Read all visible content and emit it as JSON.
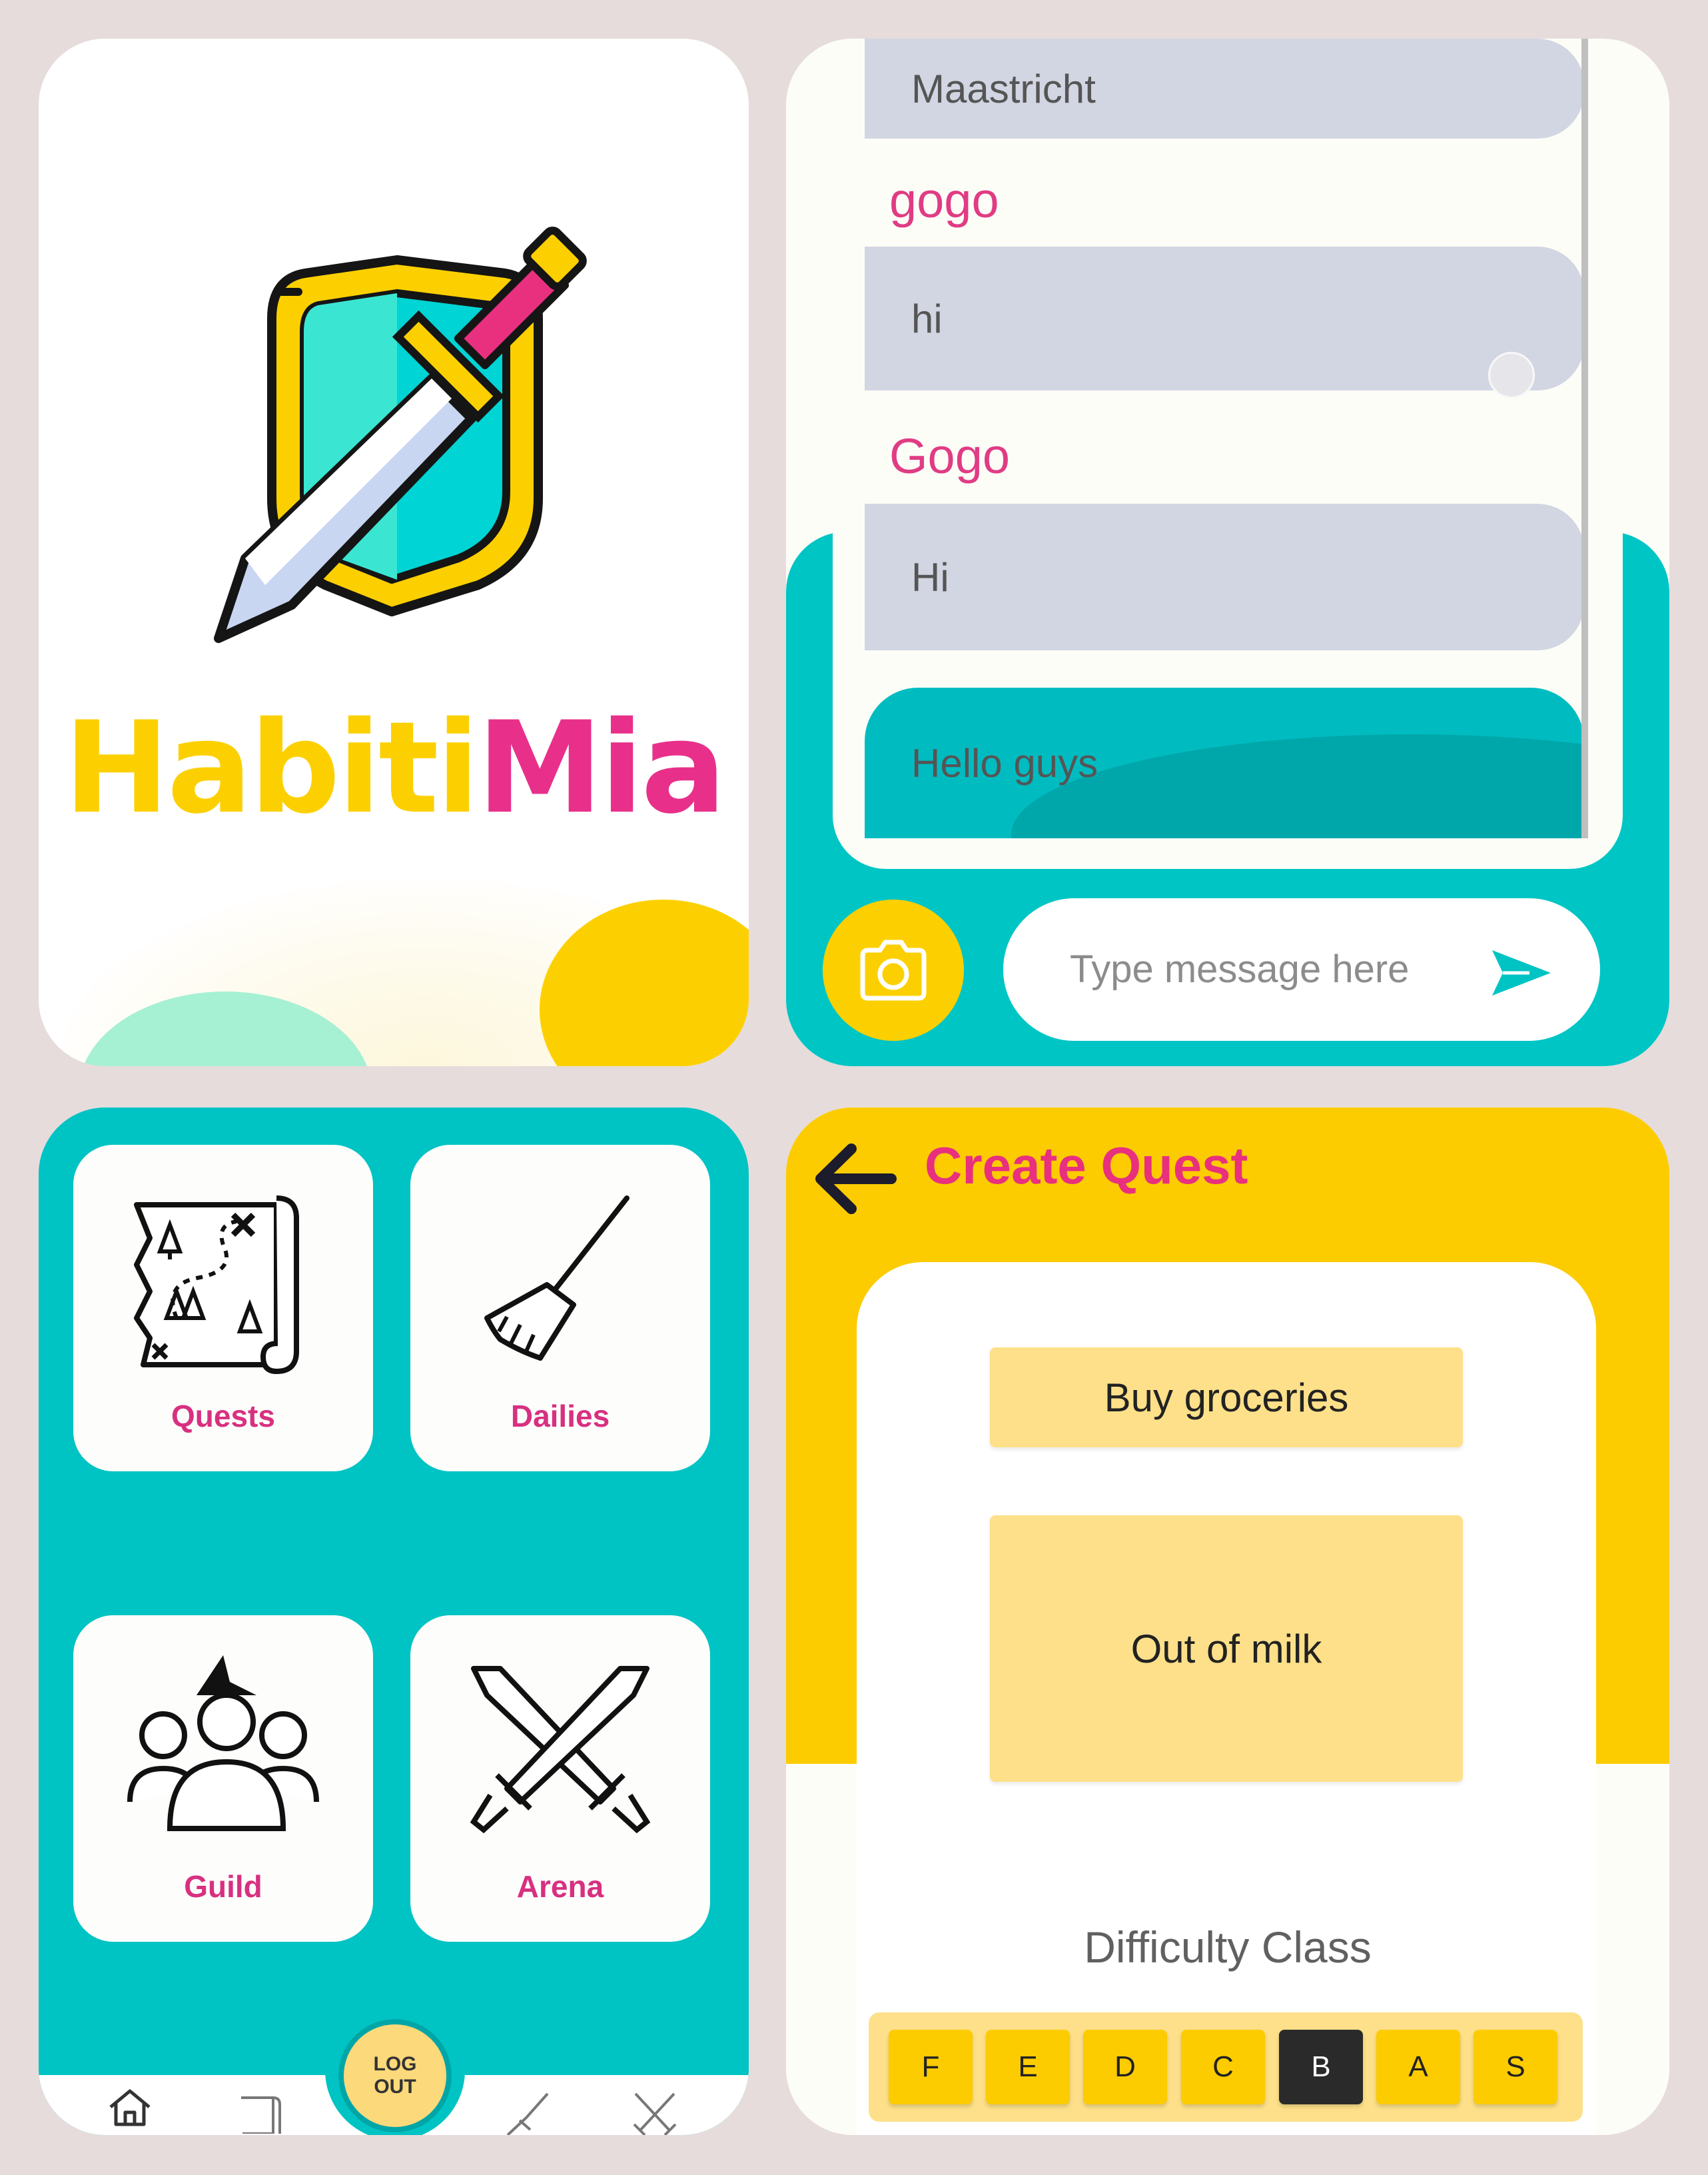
{
  "splash": {
    "brand_part1": "Habiti",
    "brand_part2": "Mia"
  },
  "chat": {
    "messages": [
      {
        "sender": "",
        "text": "Maastricht"
      },
      {
        "sender": "gogo",
        "text": "hi"
      },
      {
        "sender": "Gogo",
        "text": "Hi"
      },
      {
        "sender": "",
        "text": "Hello guys"
      }
    ],
    "input_placeholder": "Type message here"
  },
  "menu": {
    "tiles": [
      {
        "label": "Quests",
        "icon": "treasure-map-icon"
      },
      {
        "label": "Dailies",
        "icon": "broom-icon"
      },
      {
        "label": "Guild",
        "icon": "group-wizard-icon"
      },
      {
        "label": "Arena",
        "icon": "crossed-swords-icon"
      }
    ],
    "logout_line1": "LOG",
    "logout_line2": "OUT"
  },
  "create_quest": {
    "title": "Create Quest",
    "quest_name": "Buy groceries",
    "quest_description": "Out of milk",
    "difficulty_label": "Difficulty Class",
    "difficulty_options": [
      "F",
      "E",
      "D",
      "C",
      "B",
      "A",
      "S"
    ],
    "selected_difficulty": "B"
  },
  "colors": {
    "teal": "#00c3c4",
    "yellow": "#fcd000",
    "pink": "#e8308a"
  }
}
